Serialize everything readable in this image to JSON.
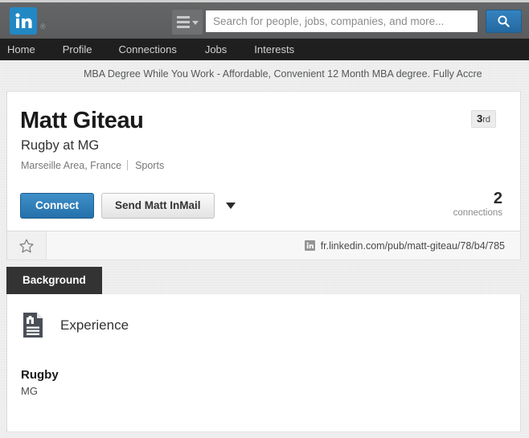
{
  "brand": {
    "logo_text": "in",
    "registered_mark": "®",
    "accent_blue": "#2288c4"
  },
  "search": {
    "placeholder": "Search for people, jobs, companies, and more...",
    "value": "",
    "button_icon": "search-icon",
    "menu_icon": "hamburger-menu-icon"
  },
  "nav": {
    "items": [
      {
        "label": "Home"
      },
      {
        "label": "Profile"
      },
      {
        "label": "Connections"
      },
      {
        "label": "Jobs"
      },
      {
        "label": "Interests"
      }
    ]
  },
  "ad": {
    "text": "MBA Degree While You Work - Affordable, Convenient 12 Month MBA degree. Fully Accre"
  },
  "profile": {
    "name": "Matt Giteau",
    "headline": "Rugby at MG",
    "location": "Marseille Area, France",
    "industry": "Sports",
    "degree_number": "3",
    "degree_suffix": "rd",
    "connections_count": "2",
    "connections_label": "connections",
    "actions": {
      "connect_label": "Connect",
      "inmail_label": "Send Matt InMail",
      "more_icon": "chevron-down-icon"
    }
  },
  "url_bar": {
    "star_icon": "star-outline-icon",
    "site_icon": "linkedin-mini-icon",
    "url": "fr.linkedin.com/pub/matt-giteau/78/b4/785"
  },
  "background_section": {
    "tab_label": "Background",
    "experience": {
      "icon": "document-experience-icon",
      "title": "Experience",
      "entries": [
        {
          "title": "Rugby",
          "company": "MG"
        }
      ]
    }
  }
}
